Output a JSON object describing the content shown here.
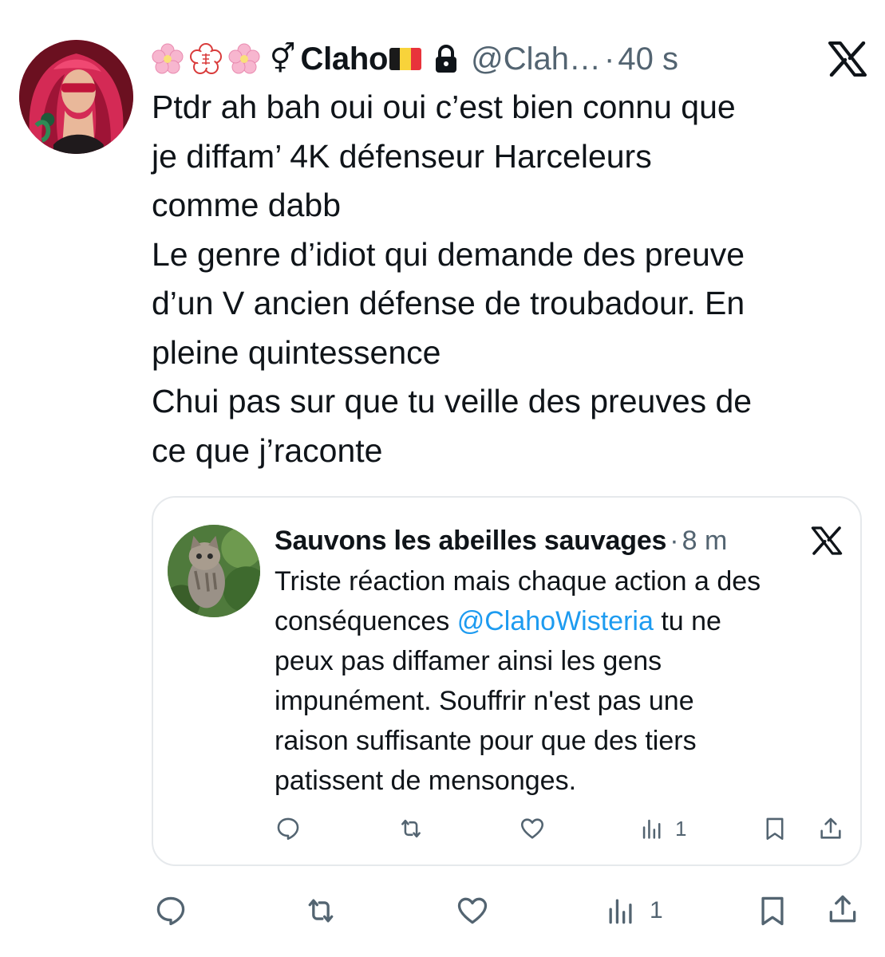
{
  "tweet": {
    "emojis": [
      "cherry-blossom-emoji",
      "japanese-seal-emoji",
      "cherry-blossom-emoji"
    ],
    "gender_symbol": "⚥",
    "display_name": "Claho",
    "flag": "belgium-flag",
    "handle": "@Clah…",
    "dot": "·",
    "time": "40 s",
    "text_lines": [
      "Ptdr ah bah oui oui c’est bien connu que",
      "je diffam’ 4K défenseur Harceleurs",
      "comme dabb",
      "Le genre d’idiot qui demande des preuve",
      "d’un V ancien défense de troubadour. En",
      "pleine quintessence",
      "Chui pas sur que tu veille des preuves de",
      "ce que j’raconte"
    ],
    "views_count": "1"
  },
  "quote": {
    "display_name": "Sauvons les abeilles sauvages",
    "dot": "·",
    "time": "8 m",
    "line1": "Triste réaction mais chaque action a des",
    "line2_before": "conséquences ",
    "line2_mention": "@ClahoWisteria",
    "line2_after": " tu ne",
    "line3": "peux pas diffamer ainsi les gens",
    "line4": "impunément. Souffrir n'est pas une",
    "line5": "raison suffisante pour que des tiers",
    "line6": "patissent de mensonges.",
    "views_count": "1"
  },
  "colors": {
    "text": "#0f1419",
    "secondary": "#536471",
    "link": "#1d9bf0",
    "border": "#e6e9ec"
  }
}
